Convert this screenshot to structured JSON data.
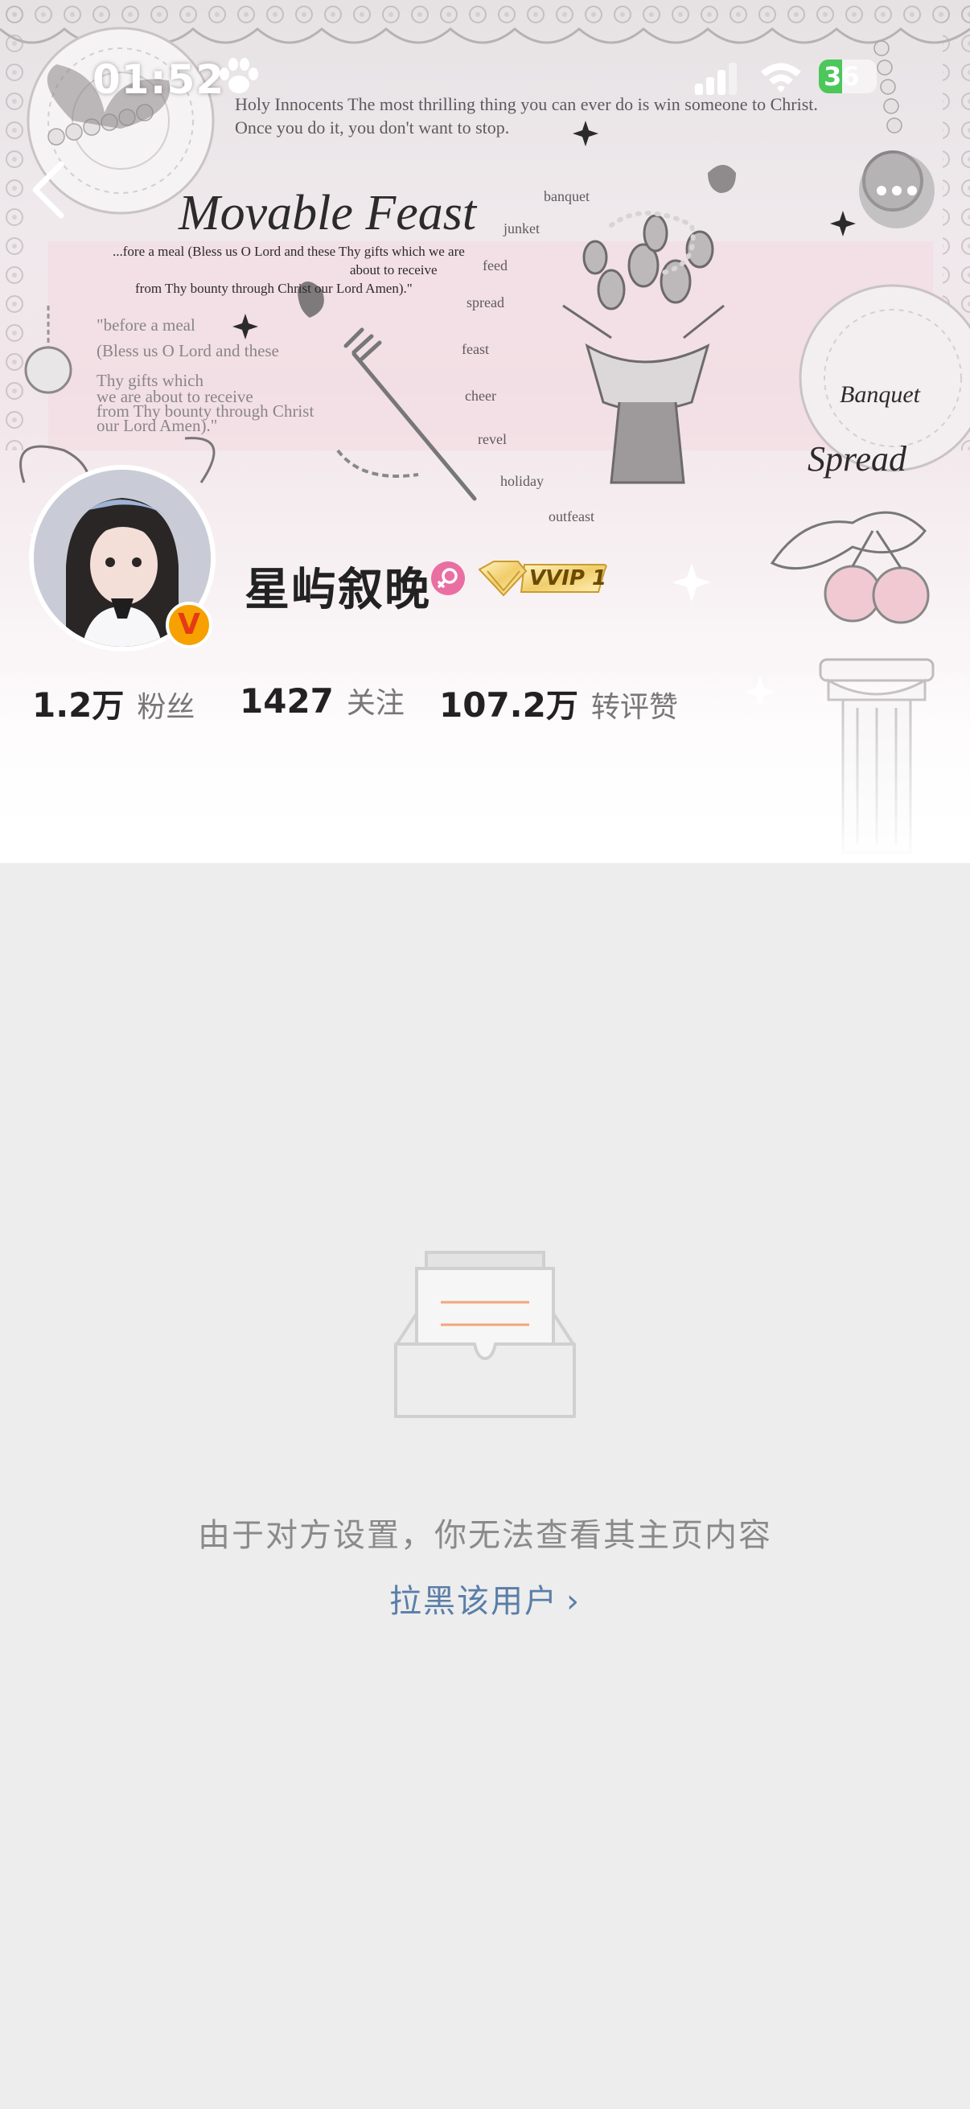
{
  "status_bar": {
    "time": "01:52",
    "battery": "36",
    "icons": [
      "paw-icon",
      "signal-icon",
      "wifi-icon",
      "battery-icon"
    ]
  },
  "cover": {
    "poem_line_1": "Holy Innocents The most thrilling thing you can ever do is win someone to Christ.",
    "poem_line_2": "Once you do it, you don't want to stop.",
    "title": "Movable Feast",
    "prayer_1": "...fore a meal (Bless us O Lord and these Thy gifts which we are",
    "prayer_2": "about to receive",
    "prayer_3": "from Thy bounty through Christ our Lord Amen).\"",
    "quote_1": "\"before a meal",
    "quote_2": "(Bless us O Lord and these",
    "quote_3": "Thy gifts which",
    "quote_4": "we are about to receive",
    "quote_5": "from Thy bounty through Christ",
    "quote_6": "our Lord Amen).\"",
    "words": [
      "banquet",
      "junket",
      "feed",
      "spread",
      "feast",
      "cheer",
      "revel",
      "holiday",
      "outfeast"
    ],
    "script_1": "Banquet",
    "script_2": "Spread"
  },
  "profile": {
    "username": "星屿叙晚",
    "vip_label": "VVIP 1",
    "stats": {
      "fans": {
        "value": "1.2",
        "unit": "万",
        "label": "粉丝"
      },
      "following": {
        "value": "1427",
        "unit": "",
        "label": "关注"
      },
      "engagement": {
        "value": "107.2",
        "unit": "万",
        "label": "转评赞"
      }
    }
  },
  "empty_state": {
    "message": "由于对方设置，你无法查看其主页内容",
    "block_link": "拉黑该用户",
    "chevron": "›"
  },
  "colors": {
    "page_bg": "#ededed",
    "link": "#5a7ea8",
    "gender": "#e96fa3",
    "verified": "#f7a100",
    "battery": "#4cc75a"
  }
}
